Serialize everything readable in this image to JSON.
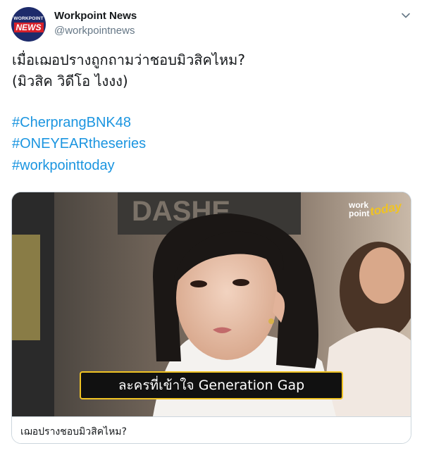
{
  "author": {
    "avatar_top": "WORKPOINT",
    "avatar_bottom": "NEWS",
    "name": "Workpoint News",
    "handle": "@workpointnews"
  },
  "tweet": {
    "line1": "เมื่อเฌอปรางถูกถามว่าชอบมิวสิคไหม?",
    "line2": "(มิวสิค วิดีโอ ไงงง)",
    "hashtags": [
      "#CherprangBNK48",
      "#ONEYEARtheseries",
      "#workpointtoday"
    ]
  },
  "media": {
    "subtitle": "ละครที่เข้าใจ Generation Gap",
    "logo_work": "work",
    "logo_point": "point",
    "logo_today": "today"
  },
  "card": {
    "title": "เฌอปรางชอบมิวสิคไหม?"
  },
  "colors": {
    "hashtag": "#1b95e0",
    "subtitle_border": "#f0c323",
    "card_border": "#ccd6dd"
  },
  "icons": {
    "caret": "chevron-down-icon"
  }
}
